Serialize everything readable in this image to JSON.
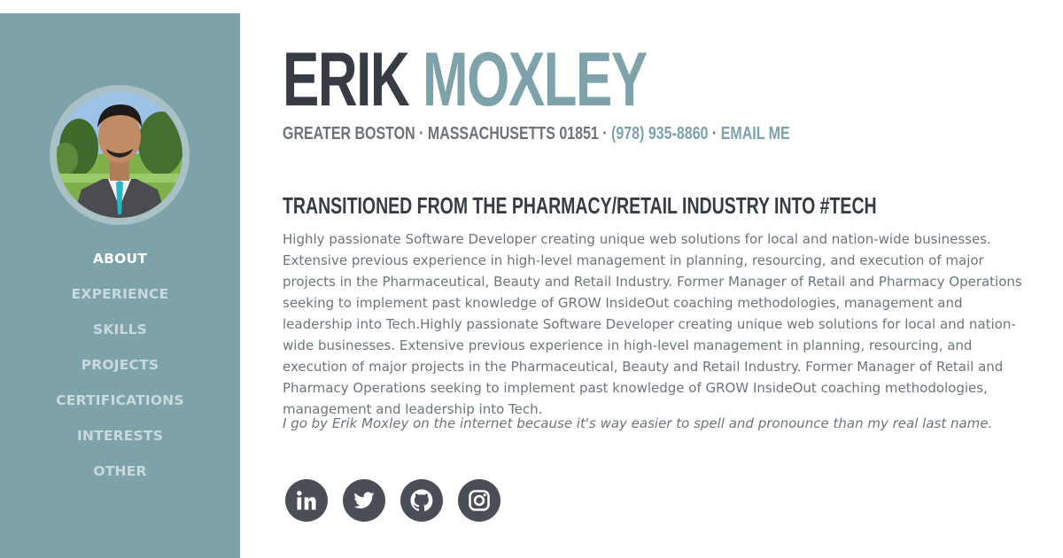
{
  "profile": {
    "first_name": "ERIK",
    "last_name": "MOXLEY",
    "location": "GREATER BOSTON · MASSACHUSETTS 01851 ·",
    "phone": "(978) 935-8860",
    "separator": "·",
    "email_label": "EMAIL ME"
  },
  "nav": {
    "items": [
      {
        "label": "ABOUT",
        "active": true
      },
      {
        "label": "EXPERIENCE"
      },
      {
        "label": "SKILLS"
      },
      {
        "label": "PROJECTS"
      },
      {
        "label": "CERTIFICATIONS"
      },
      {
        "label": "INTERESTS"
      },
      {
        "label": "OTHER"
      }
    ]
  },
  "about": {
    "heading": "TRANSITIONED FROM THE PHARMACY/RETAIL INDUSTRY INTO #TECH",
    "bio": "Highly passionate Software Developer creating unique web solutions for local and nation-wide businesses. Extensive previous experience in high-level management in planning, resourcing, and execution of major projects in the Pharmaceutical, Beauty and Retail Industry. Former Manager of Retail and Pharmacy Operations seeking to implement past knowledge of GROW InsideOut coaching methodologies, management and leadership into Tech.Highly passionate Software Developer creating unique web solutions for local and nation-wide businesses. Extensive previous experience in high-level management in planning, resourcing, and execution of major projects in the Pharmaceutical, Beauty and Retail Industry. Former Manager of Retail and Pharmacy Operations seeking to implement past knowledge of GROW InsideOut coaching methodologies, management and leadership into Tech.",
    "quote": "I go by Erik Moxley on the internet because it's way easier to spell and pronounce than my real last name."
  },
  "social": [
    {
      "icon": "linkedin-icon"
    },
    {
      "icon": "twitter-icon"
    },
    {
      "icon": "github-icon"
    },
    {
      "icon": "instagram-icon"
    }
  ],
  "colors": {
    "sidebar": "#7ea2aa",
    "accent": "#7ea2aa",
    "dark": "#373c44",
    "social_bg": "#494e57"
  }
}
